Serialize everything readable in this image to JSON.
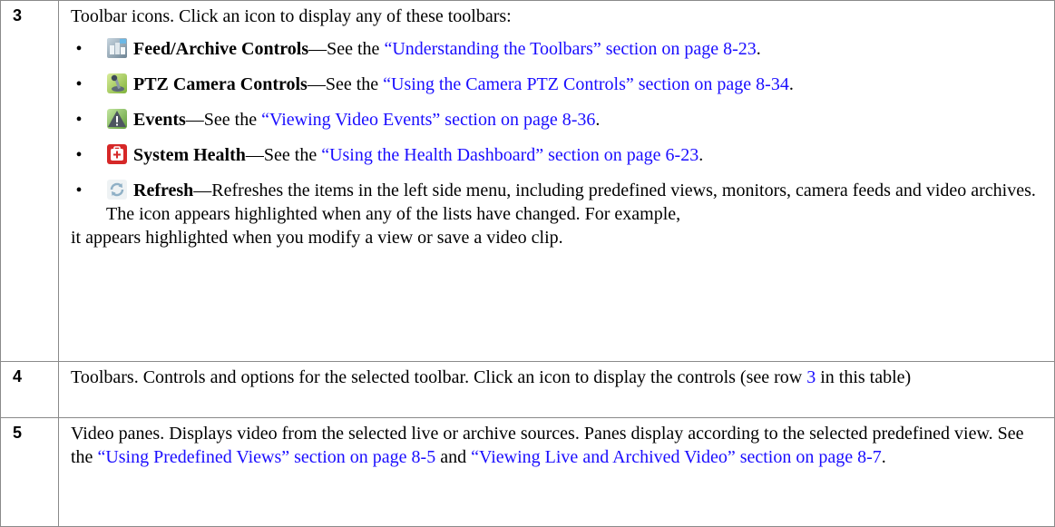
{
  "rows": [
    {
      "num": "3",
      "intro": "Toolbar icons. Click an icon to display any of these toolbars:",
      "items": [
        {
          "icon": "feed-archive-icon",
          "title": "Feed/Archive Controls",
          "text": "—See the ",
          "link": "“Understanding the Toolbars” section on page 8-23",
          "after": "."
        },
        {
          "icon": "ptz-joystick-icon",
          "title": "PTZ Camera Controls",
          "text": "—See the ",
          "link": "“Using the Camera PTZ Controls” section on page 8-34",
          "after": "."
        },
        {
          "icon": "warning-icon",
          "title": "Events",
          "text": "—See the ",
          "link": "“Viewing Video Events” section on page 8-36",
          "after": "."
        },
        {
          "icon": "health-kit-icon",
          "title": "System Health",
          "text": "—See the ",
          "link": "“Using the Health Dashboard” section on page 6-23",
          "after": "."
        },
        {
          "icon": "refresh-icon",
          "title": "Refresh",
          "text": "—Refreshes the items in the left side menu, including predefined views, monitors, camera feeds and video archives. The icon appears highlighted when any of the lists have changed. For example,",
          "text2": "it appears highlighted when you modify a view or save a video clip."
        }
      ]
    },
    {
      "num": "4",
      "text": "Toolbars. Controls and options for the selected toolbar. Click an icon to display the controls (see row ",
      "link": "3",
      "after": " in this table)"
    },
    {
      "num": "5",
      "text": "Video panes. Displays video from the selected live or archive sources. Panes display according to the selected predefined view. See the ",
      "link1": "“Using Predefined Views” section on page 8-5",
      "mid": " and ",
      "link2": "“Viewing Live and Archived Video” section on page 8-7",
      "after": "."
    }
  ],
  "bullet": "•",
  "colors": {
    "link": "#1a0dff",
    "border": "#8a8a8a"
  }
}
